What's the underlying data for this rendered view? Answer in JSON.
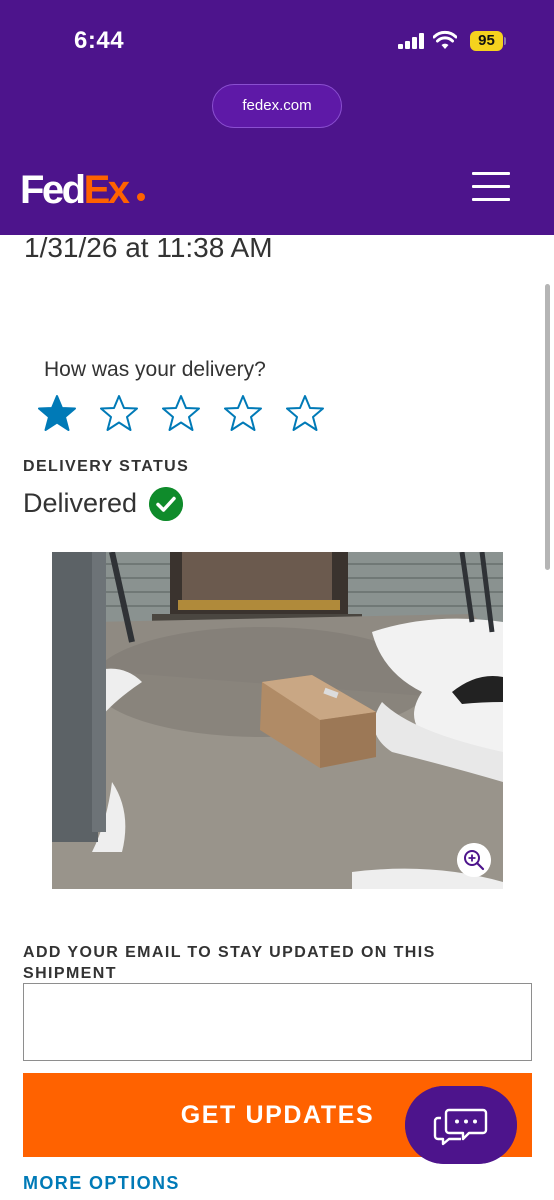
{
  "status_bar": {
    "time": "6:44",
    "battery_level": "95"
  },
  "browser": {
    "url": "fedex.com"
  },
  "header": {
    "logo_part1": "Fed",
    "logo_part2": "Ex",
    "brand_colors": {
      "purple": "#4d148c",
      "orange": "#ff6200"
    },
    "menu_icon": "hamburger-icon"
  },
  "tracking": {
    "delivery_datetime": "1/31/26 at 11:38 AM",
    "rating": {
      "question": "How was your delivery?",
      "selected": 1,
      "max": 5
    },
    "status_label": "DELIVERY STATUS",
    "status_value": "Delivered",
    "status_color": "#0f8b2b",
    "photo": {
      "kind": "proof-of-delivery-photo",
      "zoom_icon": "zoom-in-icon"
    }
  },
  "notifications": {
    "email_label": "ADD YOUR EMAIL TO STAY UPDATED ON THIS SHIPMENT",
    "email_value": "",
    "get_updates_label": "GET UPDATES",
    "more_options_label": "MORE OPTIONS",
    "chat_icon": "chat-bubbles-icon"
  }
}
